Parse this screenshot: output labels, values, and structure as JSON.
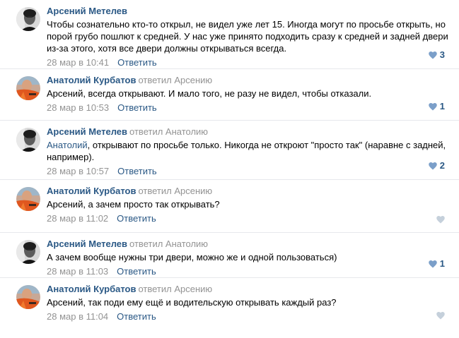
{
  "comments": [
    {
      "author": "Арсений Метелев",
      "replied_to": "",
      "mention": "",
      "text": "Чтобы сознательно кто-то открыл, не видел уже лет 15. Иногда могут по просьбе открыть, но порой грубо пошлют к средней. У нас уже принято подходить сразу к средней и задней двери из-за этого, хотя все двери должны открываться всегда.",
      "date": "28 мар в 10:41",
      "reply_label": "Ответить",
      "likes": "3",
      "avatar": "avatar-arseny"
    },
    {
      "author": "Анатолий Курбатов",
      "replied_to": "ответил Арсению",
      "mention": "",
      "text": "Арсений, всегда открывают. И мало того, не разу не видел, чтобы отказали.",
      "date": "28 мар в 10:53",
      "reply_label": "Ответить",
      "likes": "1",
      "avatar": "avatar-anatoly"
    },
    {
      "author": "Арсений Метелев",
      "replied_to": "ответил Анатолию",
      "mention": "Анатолий",
      "text": ", открывают по просьбе только. Никогда не откроют \"просто так\" (наравне с задней, например).",
      "date": "28 мар в 10:57",
      "reply_label": "Ответить",
      "likes": "2",
      "avatar": "avatar-arseny"
    },
    {
      "author": "Анатолий Курбатов",
      "replied_to": "ответил Арсению",
      "mention": "",
      "text": "Арсений, а зачем просто так открывать?",
      "date": "28 мар в 11:02",
      "reply_label": "Ответить",
      "likes": "",
      "avatar": "avatar-anatoly"
    },
    {
      "author": "Арсений Метелев",
      "replied_to": "ответил Анатолию",
      "mention": "",
      "text": "А зачем вообще нужны три двери, можно же и одной пользоваться)",
      "date": "28 мар в 11:03",
      "reply_label": "Ответить",
      "likes": "1",
      "avatar": "avatar-arseny"
    },
    {
      "author": "Анатолий Курбатов",
      "replied_to": "ответил Арсению",
      "mention": "",
      "text": "Арсений, так поди ему ещё и водительскую открывать каждый раз?",
      "date": "28 мар в 11:04",
      "reply_label": "Ответить",
      "likes": "",
      "avatar": "avatar-anatoly"
    }
  ],
  "colors": {
    "link": "#2a5885",
    "muted": "#939393",
    "divider": "#e7e8ec",
    "heart_active": "#7b9fc9",
    "heart_empty": "#c5d0db"
  }
}
